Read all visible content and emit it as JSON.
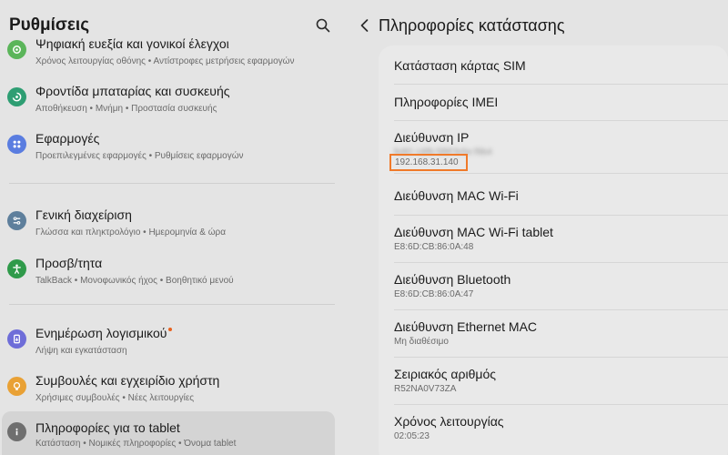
{
  "settings_panel": {
    "title": "Ρυθμίσεις",
    "items": [
      {
        "title": "Ψηφιακή ευεξία και γονικοί έλεγχοι",
        "subtitle": "Χρόνος λειτουργίας οθόνης  •  Αντίστροφες μετρήσεις εφαρμογών",
        "icon": "wellbeing-icon",
        "color": "#5bb55a"
      },
      {
        "title": "Φροντίδα μπαταρίας και συσκευής",
        "subtitle": "Αποθήκευση  •  Μνήμη  •  Προστασία συσκευής",
        "icon": "device-care-icon",
        "color": "#2e9e73"
      },
      {
        "title": "Εφαρμογές",
        "subtitle": "Προεπιλεγμένες εφαρμογές  •  Ρυθμίσεις εφαρμογών",
        "icon": "apps-icon",
        "color": "#5a7de0"
      },
      {
        "title": "Γενική διαχείριση",
        "subtitle": "Γλώσσα και πληκτρολόγιο  •  Ημερομηνία & ώρα",
        "icon": "general-management-icon",
        "color": "#5e7f9c"
      },
      {
        "title": "Προσβ/τητα",
        "subtitle": "TalkBack  •  Μονοφωνικός ήχος  •  Βοηθητικό μενού",
        "icon": "accessibility-icon",
        "color": "#2f9a4a"
      },
      {
        "title": "Ενημέρωση λογισμικού",
        "subtitle": "Λήψη και εγκατάσταση",
        "icon": "software-update-icon",
        "color": "#6e6dd8",
        "badge": true
      },
      {
        "title": "Συμβουλές και εγχειρίδιο χρήστη",
        "subtitle": "Χρήσιμες συμβουλές  •  Νέες λειτουργίες",
        "icon": "tips-icon",
        "color": "#e9a135"
      },
      {
        "title": "Πληροφορίες για το tablet",
        "subtitle": "Κατάσταση  •  Νομικές πληροφορίες  •  Όνομα tablet",
        "icon": "about-tablet-icon",
        "color": "#6f6f6f",
        "selected": true
      }
    ]
  },
  "status_panel": {
    "title": "Πληροφορίες κατάστασης",
    "rows": [
      {
        "label": "Κατάσταση κάρτας SIM"
      },
      {
        "label": "Πληροφορίες IMEI"
      },
      {
        "label": "Διεύθυνση IP",
        "value_blur": "fe80::c8fb:5f8f:fe5e:f9b4",
        "value_ip": "192.168.31.140"
      },
      {
        "label": "Διεύθυνση MAC Wi-Fi"
      },
      {
        "label": "Διεύθυνση MAC Wi-Fi tablet",
        "value": "E8:6D:CB:86:0A:48"
      },
      {
        "label": "Διεύθυνση Bluetooth",
        "value": "E8:6D:CB:86:0A:47"
      },
      {
        "label": "Διεύθυνση Ethernet MAC",
        "value": "Μη διαθέσιμο"
      },
      {
        "label": "Σειριακός αριθμός",
        "value": "R52NA0V73ZA"
      },
      {
        "label": "Χρόνος λειτουργίας",
        "value": "02:05:23"
      }
    ]
  },
  "colors": {
    "highlight": "#f07a2a",
    "badge": "#e8621f"
  }
}
